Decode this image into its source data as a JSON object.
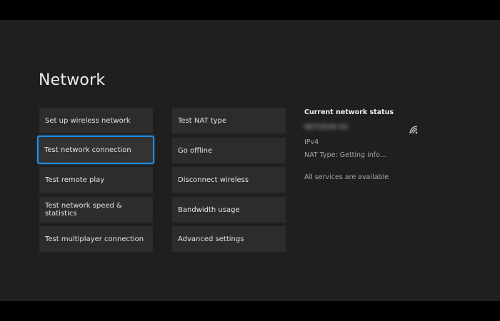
{
  "page": {
    "title": "Network"
  },
  "menu": {
    "left": [
      {
        "label": "Set up wireless network"
      },
      {
        "label": "Test network connection"
      },
      {
        "label": "Test remote play"
      },
      {
        "label": "Test network speed & statistics"
      },
      {
        "label": "Test multiplayer connection"
      }
    ],
    "right": [
      {
        "label": "Test NAT type"
      },
      {
        "label": "Go offline"
      },
      {
        "label": "Disconnect wireless"
      },
      {
        "label": "Bandwidth usage"
      },
      {
        "label": "Advanced settings"
      }
    ],
    "focused_item": "Test network connection"
  },
  "status": {
    "title": "Current network status",
    "network_name": "NETGEAR-5G",
    "network_icon": "wifi-signal-icon",
    "ip_version": "IPv4",
    "nat_type": "NAT Type: Getting info...",
    "services": "All services are available"
  },
  "colors": {
    "background": "#1f1f1f",
    "tile": "#2c2c2c",
    "focus_accent": "#1e8fe6"
  }
}
